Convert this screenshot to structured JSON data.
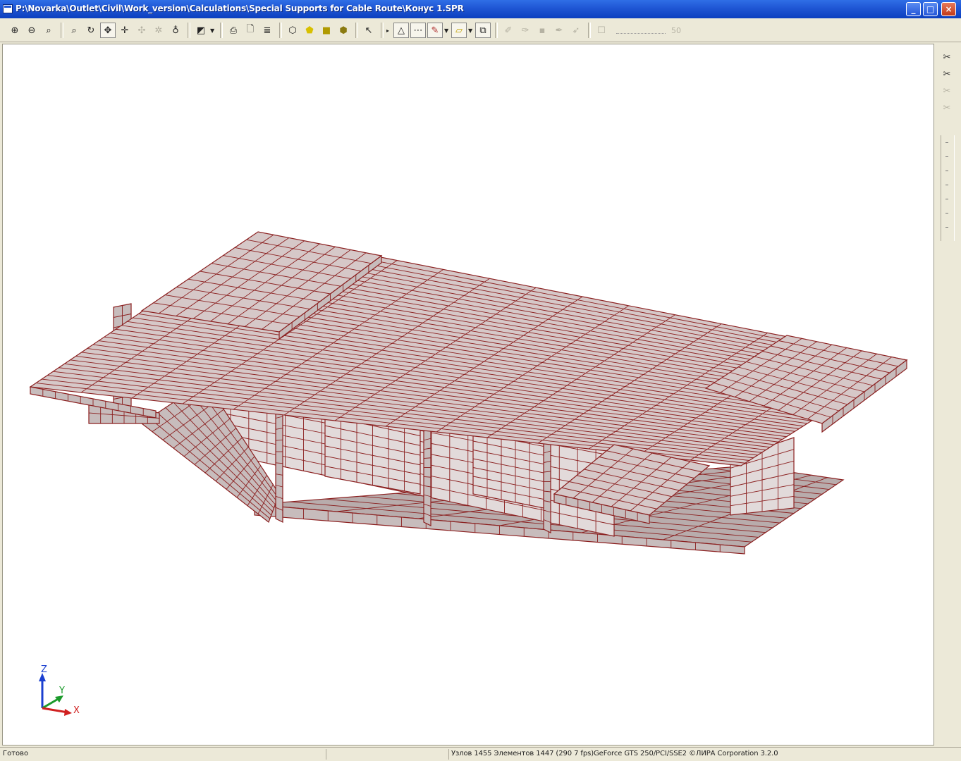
{
  "window": {
    "title": "P:\\Novarka\\Outlet\\Civil\\Work_version\\Calculations\\Special Supports for Cable Route\\Конус 1.SPR",
    "buttons": {
      "minimize": "_",
      "maximize": "□",
      "close": "×"
    }
  },
  "toolbar": {
    "icons": [
      "zoom-in-icon",
      "zoom-out-icon",
      "zoom-window-icon",
      "zoom-extents-icon",
      "rotate-icon",
      "pan-icon",
      "move-icon",
      "node-icon",
      "element-icon",
      "filter-icon",
      "projection-icon",
      "print-icon",
      "print-preview-icon",
      "report-icon",
      "wireframe-icon",
      "shaded-icon",
      "solid-icon",
      "cube-icon",
      "select-icon",
      "triangle-icon",
      "grid-icon",
      "brush-icon",
      "polygon-icon",
      "layer-icon",
      "draw-icon",
      "edit-icon",
      "square-icon",
      "pen-icon",
      "arrow-icon",
      "checkbox-icon"
    ],
    "zoom_value": "50"
  },
  "viewport": {
    "background": "#ffffff",
    "plate_fill": "#d6c8c8",
    "mesh_color": "#8b2020",
    "axes": {
      "x": "X",
      "y": "Y",
      "z": "Z"
    }
  },
  "vtoolbar": {
    "icons": [
      "pin-icon",
      "pin2-icon",
      "tool-icon",
      "close-tool-icon"
    ]
  },
  "statusbar": {
    "ready": "Готово",
    "info": "Узлов 1455 Элементов 1447 (290 7 fps)GeForce GTS 250/PCI/SSE2 ©ЛИРА Corporation 3.2.0"
  }
}
